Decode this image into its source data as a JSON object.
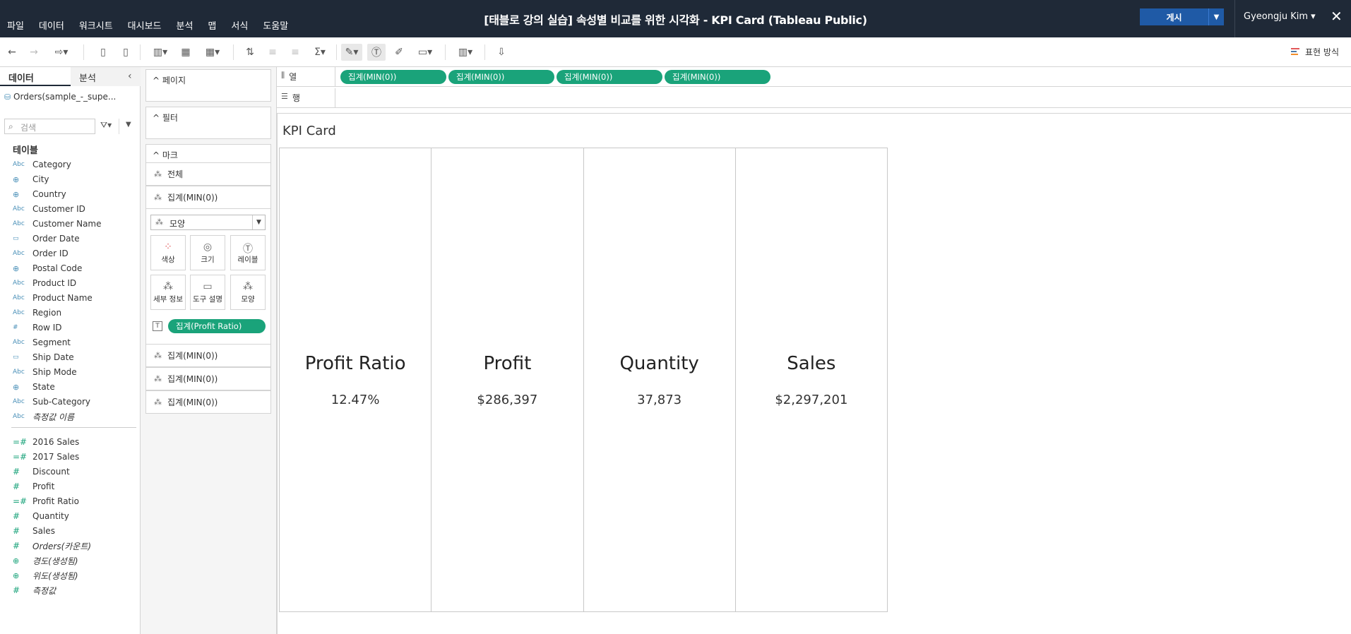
{
  "menu": [
    "파일",
    "데이터",
    "워크시트",
    "대시보드",
    "분석",
    "맵",
    "서식",
    "도움말"
  ],
  "window_title": "[태블로 강의 실습] 속성별 비교를 위한 시각화 - KPI Card (Tableau Public)",
  "publish_label": "게시",
  "user_name": "Gyeongju Kim ▾",
  "show_me_label": "표현 방식",
  "data_pane": {
    "tab_data": "데이터",
    "tab_analysis": "분석",
    "datasource": "Orders(sample_-_supe...",
    "search_placeholder": "검색",
    "section_title": "테이블",
    "dimensions": [
      {
        "icon": "Abc",
        "name": "Category"
      },
      {
        "icon": "⊕",
        "name": "City"
      },
      {
        "icon": "⊕",
        "name": "Country"
      },
      {
        "icon": "Abc",
        "name": "Customer ID"
      },
      {
        "icon": "Abc",
        "name": "Customer Name"
      },
      {
        "icon": "▭",
        "name": "Order Date"
      },
      {
        "icon": "Abc",
        "name": "Order ID"
      },
      {
        "icon": "⊕",
        "name": "Postal Code"
      },
      {
        "icon": "Abc",
        "name": "Product ID"
      },
      {
        "icon": "Abc",
        "name": "Product Name"
      },
      {
        "icon": "Abc",
        "name": "Region"
      },
      {
        "icon": "#",
        "name": "Row ID"
      },
      {
        "icon": "Abc",
        "name": "Segment"
      },
      {
        "icon": "▭",
        "name": "Ship Date"
      },
      {
        "icon": "Abc",
        "name": "Ship Mode"
      },
      {
        "icon": "⊕",
        "name": "State"
      },
      {
        "icon": "Abc",
        "name": "Sub-Category"
      },
      {
        "icon": "Abc",
        "name": "측정값 이름"
      }
    ],
    "measures": [
      {
        "icon": "=#",
        "name": "2016 Sales"
      },
      {
        "icon": "=#",
        "name": "2017 Sales"
      },
      {
        "icon": "#",
        "name": "Discount"
      },
      {
        "icon": "#",
        "name": "Profit"
      },
      {
        "icon": "=#",
        "name": "Profit Ratio"
      },
      {
        "icon": "#",
        "name": "Quantity"
      },
      {
        "icon": "#",
        "name": "Sales"
      },
      {
        "icon": "#",
        "name": "Orders(카운트)"
      },
      {
        "icon": "⊕",
        "name": "경도(생성됨)"
      },
      {
        "icon": "⊕",
        "name": "위도(생성됨)"
      },
      {
        "icon": "#",
        "name": "측정값"
      }
    ]
  },
  "cards": {
    "pages": "페이지",
    "filters": "필터",
    "marks": "마크",
    "marks_all": "전체",
    "marks_agg1": "집계(MIN(0))",
    "mark_type": "모양",
    "buttons": [
      "색상",
      "크기",
      "레이블",
      "세부 정보",
      "도구 설명",
      "모양"
    ],
    "label_pill": "집계(Profit Ratio)",
    "marks_agg2": "집계(MIN(0))",
    "marks_agg3": "집계(MIN(0))",
    "marks_agg4": "집계(MIN(0))"
  },
  "shelves": {
    "columns_label": "열",
    "rows_label": "행",
    "column_pills": [
      "집계(MIN(0))",
      "집계(MIN(0))",
      "집계(MIN(0))",
      "집계(MIN(0))"
    ]
  },
  "view": {
    "title": "KPI Card",
    "kpis": [
      {
        "label": "Profit Ratio",
        "value": "12.47%"
      },
      {
        "label": "Profit",
        "value": "$286,397"
      },
      {
        "label": "Quantity",
        "value": "37,873"
      },
      {
        "label": "Sales",
        "value": "$2,297,201"
      }
    ]
  },
  "colors": {
    "topbar": "#1f2937",
    "publish": "#1f5aa6",
    "pill_green": "#1aa37a",
    "dimension_icon": "#4a90b8"
  }
}
